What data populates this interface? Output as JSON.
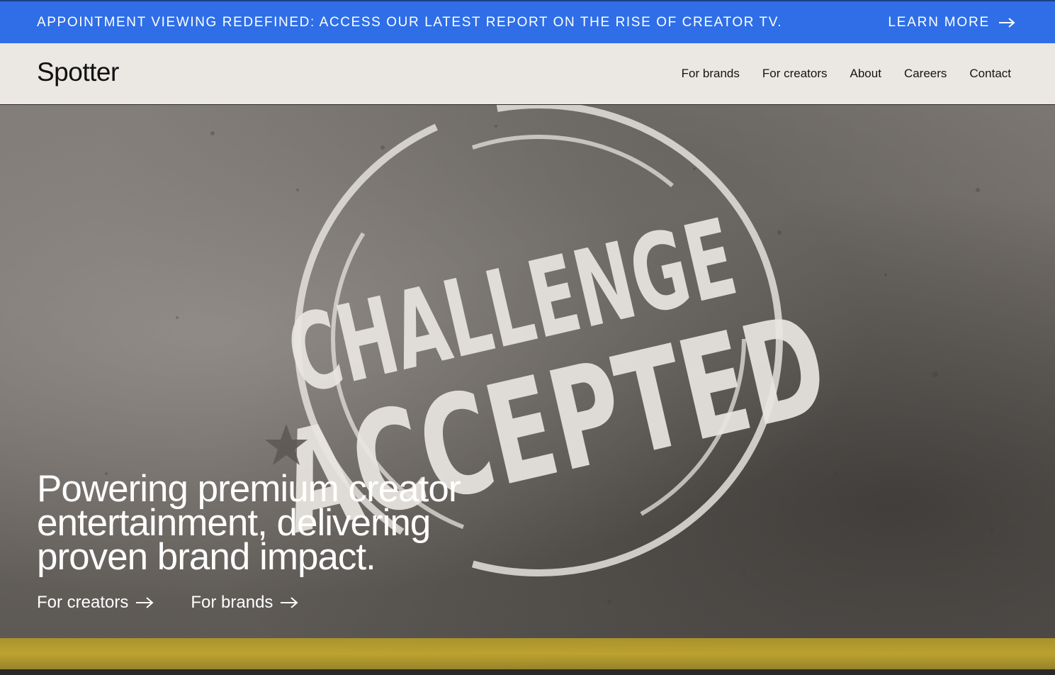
{
  "banner": {
    "text": "APPOINTMENT VIEWING REDEFINED: ACCESS OUR LATEST REPORT ON THE RISE OF CREATOR TV.",
    "link_label": "LEARN MORE",
    "link_icon": "arrow-right-icon",
    "background": "#2f6ee6"
  },
  "header": {
    "logo": "Spotter",
    "nav": [
      {
        "label": "For brands"
      },
      {
        "label": "For creators"
      },
      {
        "label": "About"
      },
      {
        "label": "Careers"
      },
      {
        "label": "Contact"
      }
    ]
  },
  "hero": {
    "image_text_line1": "CHALLENGE",
    "image_text_line2": "ACCEPTED",
    "headline_line1": "Powering premium creator",
    "headline_line2": "entertainment, delivering",
    "headline_line3": "proven brand impact.",
    "cta_creators": "For creators",
    "cta_brands": "For brands",
    "cta_icon": "arrow-right-icon"
  }
}
